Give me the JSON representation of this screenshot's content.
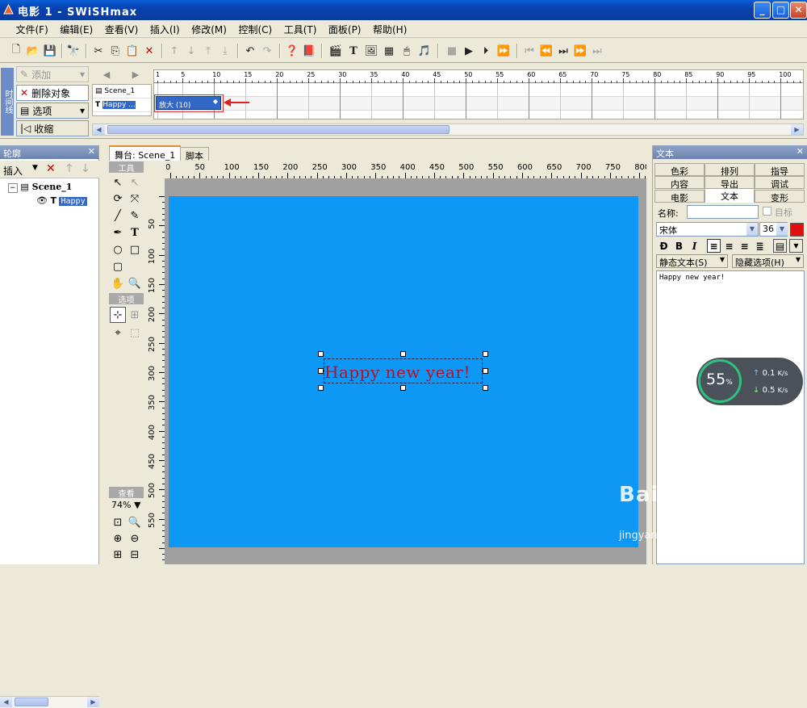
{
  "window": {
    "title": "电影 1 - SWiSHmax",
    "minimize": "_",
    "maximize": "□",
    "close": "✕"
  },
  "menu": [
    "文件(F)",
    "编辑(E)",
    "查看(V)",
    "插入(I)",
    "修改(M)",
    "控制(C)",
    "工具(T)",
    "面板(P)",
    "帮助(H)"
  ],
  "timeline": {
    "side_tab": "时间线",
    "add_label": "添加",
    "delete_label": "删除对象",
    "options_label": "选项",
    "collapse_label": "收缩",
    "scene_row": "Scene_1",
    "object_row": "Happy ...",
    "tween_label": "放大 (10)",
    "ruler_numbers": [
      "1",
      "5",
      "10",
      "15",
      "20",
      "25",
      "30",
      "35",
      "40",
      "45",
      "50",
      "55",
      "60",
      "65",
      "70",
      "75",
      "80",
      "85",
      "90",
      "95",
      "100"
    ]
  },
  "outline": {
    "title": "轮廓",
    "insert_label": "插入",
    "scene": "Scene_1",
    "object_type": "T",
    "object": "Happy"
  },
  "stage": {
    "tab_stage": "舞台: Scene_1",
    "tab_script": "脚本",
    "tools_label": "工具",
    "options_label": "选项",
    "view_label": "查看",
    "zoom": "74%",
    "hruler": [
      "0",
      "50",
      "100",
      "150",
      "200",
      "250",
      "300",
      "350",
      "400",
      "450",
      "500",
      "550",
      "600",
      "650",
      "700",
      "750",
      "800"
    ],
    "vruler": [
      "50",
      "100",
      "150",
      "200",
      "250",
      "300",
      "350",
      "400",
      "450",
      "500",
      "550"
    ],
    "canvas_color": "#0d98f5",
    "text": "Happy new year!",
    "text_color": "#b4102d"
  },
  "text_panel": {
    "title": "文本",
    "tabs_row1": [
      "色彩",
      "排列",
      "指导"
    ],
    "tabs_row2": [
      "内容",
      "导出",
      "调试"
    ],
    "tabs_row3": [
      "电影",
      "文本",
      "变形"
    ],
    "name_label": "名称:",
    "name_value": "",
    "target_label": "目标",
    "font": "宋体",
    "size": "36",
    "font_color": "#e01010",
    "text_type": "静态文本(S)",
    "hide_options": "隐藏选项(H)",
    "content": "Happy new year!"
  },
  "speed_widget": {
    "percent": "55",
    "percent_unit": "%",
    "up": "0.1",
    "down": "0.5",
    "unit": "K/s"
  },
  "watermark": {
    "brand": "Bai du 经验",
    "url": "jingyan.baidu.com"
  }
}
